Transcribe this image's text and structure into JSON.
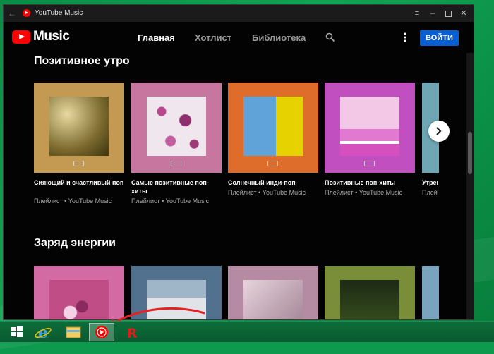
{
  "window": {
    "title": "YouTube Music"
  },
  "header": {
    "logo_text": "Music",
    "nav": [
      {
        "label": "Главная",
        "active": true
      },
      {
        "label": "Хотлист",
        "active": false
      },
      {
        "label": "Библиотека",
        "active": false
      }
    ],
    "login_label": "ВОЙТИ"
  },
  "sections": [
    {
      "title": "Позитивное утро",
      "cards": [
        {
          "title": "Сияющий и счастливый поп",
          "subtitle": "Плейлист • YouTube Music",
          "bg": "#c49a52",
          "art": "#7c6a2e"
        },
        {
          "title": "Самые позитивные поп-хиты",
          "subtitle": "Плейлист • YouTube Music",
          "bg": "#c7779f",
          "art": "#d9c7d8"
        },
        {
          "title": "Солнечный инди-поп",
          "subtitle": "Плейлист • YouTube Music",
          "bg": "#de6c2a",
          "art": "#5fa3d8"
        },
        {
          "title": "Позитивные поп-хиты",
          "subtitle": "Плейлист • YouTube Music",
          "bg": "#c24fc0",
          "art": "#e9a9d8"
        },
        {
          "title": "Утреннее",
          "subtitle": "Плей",
          "bg": "#6fa6b4",
          "art": "#6fa6b4"
        }
      ]
    },
    {
      "title": "Заряд энергии",
      "cards": [
        {
          "bg": "#d46aa4",
          "art": "#c04d85"
        },
        {
          "bg": "#52718f",
          "art": "#c9cfd6"
        },
        {
          "bg": "#b58aa3",
          "art": "#d7c0c9"
        },
        {
          "bg": "#7a8e3a",
          "art": "#23331a"
        },
        {
          "bg": "#7aa3bd",
          "art": "#7aa3bd"
        }
      ]
    }
  ],
  "taskbar": {
    "items": [
      "windows-start",
      "internet-explorer",
      "file-explorer",
      "youtube-music",
      "r-app"
    ]
  },
  "colors": {
    "accent": "#065fd4",
    "brand": "#ff0000"
  }
}
